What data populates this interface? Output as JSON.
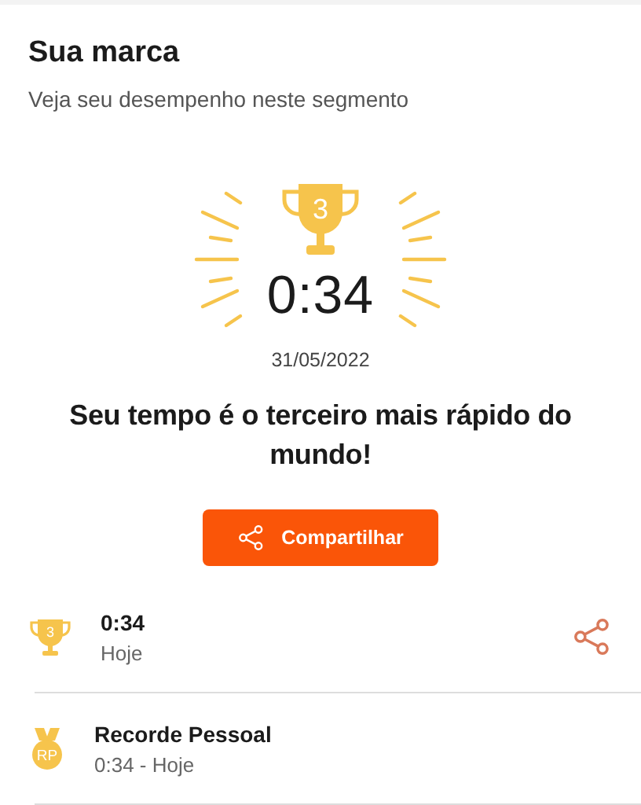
{
  "header": {
    "title": "Sua marca",
    "subtitle": "Veja seu desempenho neste segmento"
  },
  "result": {
    "rank": "3",
    "time": "0:34",
    "date": "31/05/2022",
    "message": "Seu tempo é o terceiro mais rápido do mundo!"
  },
  "share_button": {
    "label": "Compartilhar"
  },
  "rows": [
    {
      "kind": "trophy",
      "badge": "3",
      "title": "0:34",
      "subtitle": "Hoje",
      "share": true
    },
    {
      "kind": "medal",
      "badge": "RP",
      "title": "Recorde Pessoal",
      "subtitle": "0:34 - Hoje",
      "share": false
    }
  ]
}
